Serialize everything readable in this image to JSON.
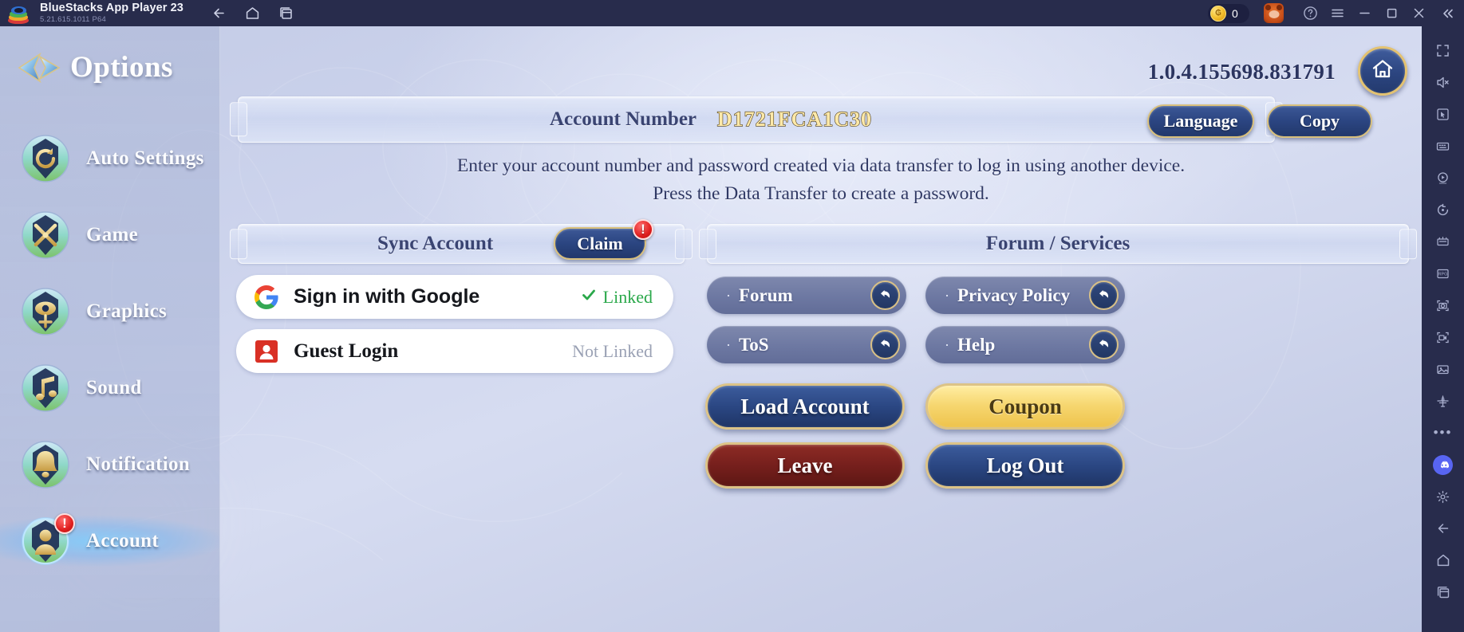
{
  "window": {
    "app_title": "BlueStacks App Player 23",
    "app_version": "5.21.615.1011  P64",
    "nav_back_icon": "arrow-left-icon",
    "nav_home_icon": "home-icon",
    "nav_multi_icon": "multi-instance-icon",
    "coin_count": "0",
    "coin_icon": "coin-icon",
    "avatar_icon": "user-avatar-icon",
    "help_icon": "question-circle-icon",
    "menu_icon": "hamburger-menu-icon",
    "minimize_icon": "minimize-icon",
    "maximize_icon": "maximize-icon",
    "close_icon": "close-icon",
    "collapse_icon": "chevron-double-left-icon"
  },
  "sidebar": {
    "title": "Options",
    "title_icon": "options-arrow-icon",
    "items": [
      {
        "label": "Auto Settings",
        "icon": "auto-settings-badge-icon",
        "active": false,
        "alert": false
      },
      {
        "label": "Game",
        "icon": "game-swords-badge-icon",
        "active": false,
        "alert": false
      },
      {
        "label": "Graphics",
        "icon": "graphics-eye-badge-icon",
        "active": false,
        "alert": false
      },
      {
        "label": "Sound",
        "icon": "sound-note-badge-icon",
        "active": false,
        "alert": false
      },
      {
        "label": "Notification",
        "icon": "notification-bell-badge-icon",
        "active": false,
        "alert": false
      },
      {
        "label": "Account",
        "icon": "account-person-badge-icon",
        "active": true,
        "alert": true,
        "alert_mark": "!"
      }
    ]
  },
  "content": {
    "game_version": "1.0.4.155698.831791",
    "home_button_icon": "house-icon",
    "account_panel": {
      "label": "Account Number",
      "value": "D1721FCA1C30",
      "language_button": "Language",
      "copy_button": "Copy"
    },
    "instructions": [
      "Enter your account number and password created via data transfer to log in using another device.",
      "Press the Data Transfer to create a password."
    ],
    "sync_panel": {
      "title": "Sync Account",
      "claim_button": "Claim",
      "claim_alert": "!"
    },
    "logins": [
      {
        "name": "Sign in with Google",
        "icon": "google-g-icon",
        "status": "Linked",
        "status_state": "linked",
        "check_icon": "checkmark-icon"
      },
      {
        "name": "Guest Login",
        "icon": "guest-user-icon",
        "status": "Not Linked",
        "status_state": "not-linked",
        "check_icon": ""
      }
    ],
    "forum_panel": {
      "title": "Forum / Services",
      "links": [
        {
          "label": "Forum",
          "bullet": "·",
          "icon": "external-link-arrow-icon"
        },
        {
          "label": "Privacy Policy",
          "bullet": "·",
          "icon": "external-link-arrow-icon"
        },
        {
          "label": "ToS",
          "bullet": "·",
          "icon": "external-link-arrow-icon"
        },
        {
          "label": "Help",
          "bullet": "·",
          "icon": "external-link-arrow-icon"
        }
      ]
    },
    "actions": [
      {
        "label": "Load Account",
        "style": "blue"
      },
      {
        "label": "Coupon",
        "style": "gold"
      },
      {
        "label": "Leave",
        "style": "red"
      },
      {
        "label": "Log Out",
        "style": "blue"
      }
    ]
  },
  "right_toolbar": {
    "items": [
      "fullscreen-icon",
      "mute-volume-icon",
      "cursor-pointer-icon",
      "keyboard-controls-icon",
      "macro-play-icon",
      "rotate-icon",
      "game-controls-icon",
      "rpg-mode-icon",
      "screenshot-camera-icon",
      "screen-record-icon",
      "media-gallery-icon",
      "eco-mode-icon",
      "more-options-icon",
      "discord-icon",
      "settings-gear-icon",
      "back-arrow-icon",
      "home-icon",
      "multi-instance-icon"
    ]
  },
  "colors": {
    "titlebar_bg": "#282c4c",
    "gold_border": "#dcc387",
    "navy_button": "#2a4682",
    "red_button": "#751f1c",
    "gold_button": "#f6d66f",
    "linked_green": "#2aa84a",
    "notlinked_gray": "#9aa1b4",
    "alert_red": "#e01f1f",
    "account_value_gold": "#ffe9a8",
    "discord_purple": "#5865f2"
  }
}
